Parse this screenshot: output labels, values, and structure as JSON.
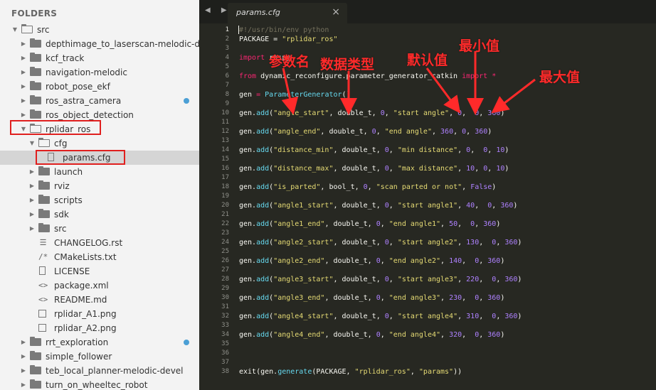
{
  "sidebar": {
    "title": "FOLDERS",
    "tree": [
      {
        "label": "src",
        "depth": 0,
        "kind": "folder",
        "open": true
      },
      {
        "label": "depthimage_to_laserscan-melodic-devel",
        "depth": 1,
        "kind": "folder"
      },
      {
        "label": "kcf_track",
        "depth": 1,
        "kind": "folder"
      },
      {
        "label": "navigation-melodic",
        "depth": 1,
        "kind": "folder"
      },
      {
        "label": "robot_pose_ekf",
        "depth": 1,
        "kind": "folder"
      },
      {
        "label": "ros_astra_camera",
        "depth": 1,
        "kind": "folder",
        "dot": true
      },
      {
        "label": "ros_object_detection",
        "depth": 1,
        "kind": "folder"
      },
      {
        "label": "rplidar_ros",
        "depth": 1,
        "kind": "folder",
        "open": true,
        "highlight": true
      },
      {
        "label": "cfg",
        "depth": 2,
        "kind": "folder",
        "open": true
      },
      {
        "label": "params.cfg",
        "depth": 3,
        "kind": "file",
        "icon": "doc",
        "selected": true,
        "highlight": true
      },
      {
        "label": "launch",
        "depth": 2,
        "kind": "folder"
      },
      {
        "label": "rviz",
        "depth": 2,
        "kind": "folder"
      },
      {
        "label": "scripts",
        "depth": 2,
        "kind": "folder"
      },
      {
        "label": "sdk",
        "depth": 2,
        "kind": "folder"
      },
      {
        "label": "src",
        "depth": 2,
        "kind": "folder"
      },
      {
        "label": "CHANGELOG.rst",
        "depth": 2,
        "kind": "file",
        "icon": "lines"
      },
      {
        "label": "CMakeLists.txt",
        "depth": 2,
        "kind": "file",
        "icon": "comment"
      },
      {
        "label": "LICENSE",
        "depth": 2,
        "kind": "file",
        "icon": "doc"
      },
      {
        "label": "package.xml",
        "depth": 2,
        "kind": "file",
        "icon": "xml"
      },
      {
        "label": "README.md",
        "depth": 2,
        "kind": "file",
        "icon": "xml"
      },
      {
        "label": "rplidar_A1.png",
        "depth": 2,
        "kind": "file",
        "icon": "img"
      },
      {
        "label": "rplidar_A2.png",
        "depth": 2,
        "kind": "file",
        "icon": "img"
      },
      {
        "label": "rrt_exploration",
        "depth": 1,
        "kind": "folder",
        "dot": true
      },
      {
        "label": "simple_follower",
        "depth": 1,
        "kind": "folder"
      },
      {
        "label": "teb_local_planner-melodic-devel",
        "depth": 1,
        "kind": "folder"
      },
      {
        "label": "turn_on_wheeltec_robot",
        "depth": 1,
        "kind": "folder"
      }
    ]
  },
  "tabbar": {
    "nav_arrows": "◀ ▶",
    "active_tab": "params.cfg",
    "close": "×"
  },
  "editor": {
    "active_line": 1,
    "lines": [
      {
        "n": 1,
        "tokens": [
          [
            "cm",
            "#!/usr/bin/env python"
          ]
        ]
      },
      {
        "n": 2,
        "tokens": [
          [
            "plain",
            "PACKAGE = "
          ],
          [
            "str",
            "\"rplidar_ros\""
          ]
        ]
      },
      {
        "n": 3,
        "tokens": []
      },
      {
        "n": 4,
        "tokens": [
          [
            "kw",
            "import"
          ],
          [
            "plain",
            " rospy"
          ]
        ]
      },
      {
        "n": 5,
        "tokens": []
      },
      {
        "n": 6,
        "tokens": [
          [
            "kw",
            "from"
          ],
          [
            "plain",
            " dynamic_reconfigure.parameter_generator_catkin "
          ],
          [
            "kw",
            "import"
          ],
          [
            "plain",
            " "
          ],
          [
            "kw",
            "*"
          ]
        ]
      },
      {
        "n": 7,
        "tokens": []
      },
      {
        "n": 8,
        "tokens": [
          [
            "plain",
            "gen "
          ],
          [
            "kw",
            "="
          ],
          [
            "plain",
            " "
          ],
          [
            "fn",
            "ParameterGenerator"
          ],
          [
            "plain",
            "()"
          ]
        ]
      },
      {
        "n": 9,
        "tokens": []
      },
      {
        "n": 10,
        "tokens": [
          [
            "plain",
            "gen."
          ],
          [
            "fn",
            "add"
          ],
          [
            "plain",
            "("
          ],
          [
            "str",
            "\"angle_start\""
          ],
          [
            "plain",
            ", double_t, "
          ],
          [
            "num",
            "0"
          ],
          [
            "plain",
            ", "
          ],
          [
            "str",
            "\"start angle\""
          ],
          [
            "plain",
            ", "
          ],
          [
            "num",
            "0"
          ],
          [
            "plain",
            ",  "
          ],
          [
            "num",
            "0"
          ],
          [
            "plain",
            ", "
          ],
          [
            "num",
            "360"
          ],
          [
            "plain",
            ")"
          ]
        ]
      },
      {
        "n": 11,
        "tokens": []
      },
      {
        "n": 12,
        "tokens": [
          [
            "plain",
            "gen."
          ],
          [
            "fn",
            "add"
          ],
          [
            "plain",
            "("
          ],
          [
            "str",
            "\"angle_end\""
          ],
          [
            "plain",
            ", double_t, "
          ],
          [
            "num",
            "0"
          ],
          [
            "plain",
            ", "
          ],
          [
            "str",
            "\"end angle\""
          ],
          [
            "plain",
            ", "
          ],
          [
            "num",
            "360"
          ],
          [
            "plain",
            ", "
          ],
          [
            "num",
            "0"
          ],
          [
            "plain",
            ", "
          ],
          [
            "num",
            "360"
          ],
          [
            "plain",
            ")"
          ]
        ]
      },
      {
        "n": 13,
        "tokens": []
      },
      {
        "n": 14,
        "tokens": [
          [
            "plain",
            "gen."
          ],
          [
            "fn",
            "add"
          ],
          [
            "plain",
            "("
          ],
          [
            "str",
            "\"distance_min\""
          ],
          [
            "plain",
            ", double_t, "
          ],
          [
            "num",
            "0"
          ],
          [
            "plain",
            ", "
          ],
          [
            "str",
            "\"min distance\""
          ],
          [
            "plain",
            ", "
          ],
          [
            "num",
            "0"
          ],
          [
            "plain",
            ",  "
          ],
          [
            "num",
            "0"
          ],
          [
            "plain",
            ", "
          ],
          [
            "num",
            "10"
          ],
          [
            "plain",
            ")"
          ]
        ]
      },
      {
        "n": 15,
        "tokens": []
      },
      {
        "n": 16,
        "tokens": [
          [
            "plain",
            "gen."
          ],
          [
            "fn",
            "add"
          ],
          [
            "plain",
            "("
          ],
          [
            "str",
            "\"distance_max\""
          ],
          [
            "plain",
            ", double_t, "
          ],
          [
            "num",
            "0"
          ],
          [
            "plain",
            ", "
          ],
          [
            "str",
            "\"max distance\""
          ],
          [
            "plain",
            ", "
          ],
          [
            "num",
            "10"
          ],
          [
            "plain",
            ", "
          ],
          [
            "num",
            "0"
          ],
          [
            "plain",
            ", "
          ],
          [
            "num",
            "10"
          ],
          [
            "plain",
            ")"
          ]
        ]
      },
      {
        "n": 17,
        "tokens": []
      },
      {
        "n": 18,
        "tokens": [
          [
            "plain",
            "gen."
          ],
          [
            "fn",
            "add"
          ],
          [
            "plain",
            "("
          ],
          [
            "str",
            "\"is_parted\""
          ],
          [
            "plain",
            ", bool_t, "
          ],
          [
            "num",
            "0"
          ],
          [
            "plain",
            ", "
          ],
          [
            "str",
            "\"scan parted or not\""
          ],
          [
            "plain",
            ", "
          ],
          [
            "num",
            "False"
          ],
          [
            "plain",
            ")"
          ]
        ]
      },
      {
        "n": 19,
        "tokens": []
      },
      {
        "n": 20,
        "tokens": [
          [
            "plain",
            "gen."
          ],
          [
            "fn",
            "add"
          ],
          [
            "plain",
            "("
          ],
          [
            "str",
            "\"angle1_start\""
          ],
          [
            "plain",
            ", double_t, "
          ],
          [
            "num",
            "0"
          ],
          [
            "plain",
            ", "
          ],
          [
            "str",
            "\"start angle1\""
          ],
          [
            "plain",
            ", "
          ],
          [
            "num",
            "40"
          ],
          [
            "plain",
            ",  "
          ],
          [
            "num",
            "0"
          ],
          [
            "plain",
            ", "
          ],
          [
            "num",
            "360"
          ],
          [
            "plain",
            ")"
          ]
        ]
      },
      {
        "n": 21,
        "tokens": []
      },
      {
        "n": 22,
        "tokens": [
          [
            "plain",
            "gen."
          ],
          [
            "fn",
            "add"
          ],
          [
            "plain",
            "("
          ],
          [
            "str",
            "\"angle1_end\""
          ],
          [
            "plain",
            ", double_t, "
          ],
          [
            "num",
            "0"
          ],
          [
            "plain",
            ", "
          ],
          [
            "str",
            "\"end angle1\""
          ],
          [
            "plain",
            ", "
          ],
          [
            "num",
            "50"
          ],
          [
            "plain",
            ",  "
          ],
          [
            "num",
            "0"
          ],
          [
            "plain",
            ", "
          ],
          [
            "num",
            "360"
          ],
          [
            "plain",
            ")"
          ]
        ]
      },
      {
        "n": 23,
        "tokens": []
      },
      {
        "n": 24,
        "tokens": [
          [
            "plain",
            "gen."
          ],
          [
            "fn",
            "add"
          ],
          [
            "plain",
            "("
          ],
          [
            "str",
            "\"angle2_start\""
          ],
          [
            "plain",
            ", double_t, "
          ],
          [
            "num",
            "0"
          ],
          [
            "plain",
            ", "
          ],
          [
            "str",
            "\"start angle2\""
          ],
          [
            "plain",
            ", "
          ],
          [
            "num",
            "130"
          ],
          [
            "plain",
            ",  "
          ],
          [
            "num",
            "0"
          ],
          [
            "plain",
            ", "
          ],
          [
            "num",
            "360"
          ],
          [
            "plain",
            ")"
          ]
        ]
      },
      {
        "n": 25,
        "tokens": []
      },
      {
        "n": 26,
        "tokens": [
          [
            "plain",
            "gen."
          ],
          [
            "fn",
            "add"
          ],
          [
            "plain",
            "("
          ],
          [
            "str",
            "\"angle2_end\""
          ],
          [
            "plain",
            ", double_t, "
          ],
          [
            "num",
            "0"
          ],
          [
            "plain",
            ", "
          ],
          [
            "str",
            "\"end angle2\""
          ],
          [
            "plain",
            ", "
          ],
          [
            "num",
            "140"
          ],
          [
            "plain",
            ",  "
          ],
          [
            "num",
            "0"
          ],
          [
            "plain",
            ", "
          ],
          [
            "num",
            "360"
          ],
          [
            "plain",
            ")"
          ]
        ]
      },
      {
        "n": 27,
        "tokens": []
      },
      {
        "n": 28,
        "tokens": [
          [
            "plain",
            "gen."
          ],
          [
            "fn",
            "add"
          ],
          [
            "plain",
            "("
          ],
          [
            "str",
            "\"angle3_start\""
          ],
          [
            "plain",
            ", double_t, "
          ],
          [
            "num",
            "0"
          ],
          [
            "plain",
            ", "
          ],
          [
            "str",
            "\"start angle3\""
          ],
          [
            "plain",
            ", "
          ],
          [
            "num",
            "220"
          ],
          [
            "plain",
            ",  "
          ],
          [
            "num",
            "0"
          ],
          [
            "plain",
            ", "
          ],
          [
            "num",
            "360"
          ],
          [
            "plain",
            ")"
          ]
        ]
      },
      {
        "n": 29,
        "tokens": []
      },
      {
        "n": 30,
        "tokens": [
          [
            "plain",
            "gen."
          ],
          [
            "fn",
            "add"
          ],
          [
            "plain",
            "("
          ],
          [
            "str",
            "\"angle3_end\""
          ],
          [
            "plain",
            ", double_t, "
          ],
          [
            "num",
            "0"
          ],
          [
            "plain",
            ", "
          ],
          [
            "str",
            "\"end angle3\""
          ],
          [
            "plain",
            ", "
          ],
          [
            "num",
            "230"
          ],
          [
            "plain",
            ",  "
          ],
          [
            "num",
            "0"
          ],
          [
            "plain",
            ", "
          ],
          [
            "num",
            "360"
          ],
          [
            "plain",
            ")"
          ]
        ]
      },
      {
        "n": 31,
        "tokens": []
      },
      {
        "n": 32,
        "tokens": [
          [
            "plain",
            "gen."
          ],
          [
            "fn",
            "add"
          ],
          [
            "plain",
            "("
          ],
          [
            "str",
            "\"angle4_start\""
          ],
          [
            "plain",
            ", double_t, "
          ],
          [
            "num",
            "0"
          ],
          [
            "plain",
            ", "
          ],
          [
            "str",
            "\"start angle4\""
          ],
          [
            "plain",
            ", "
          ],
          [
            "num",
            "310"
          ],
          [
            "plain",
            ",  "
          ],
          [
            "num",
            "0"
          ],
          [
            "plain",
            ", "
          ],
          [
            "num",
            "360"
          ],
          [
            "plain",
            ")"
          ]
        ]
      },
      {
        "n": 33,
        "tokens": []
      },
      {
        "n": 34,
        "tokens": [
          [
            "plain",
            "gen."
          ],
          [
            "fn",
            "add"
          ],
          [
            "plain",
            "("
          ],
          [
            "str",
            "\"angle4_end\""
          ],
          [
            "plain",
            ", double_t, "
          ],
          [
            "num",
            "0"
          ],
          [
            "plain",
            ", "
          ],
          [
            "str",
            "\"end angle4\""
          ],
          [
            "plain",
            ", "
          ],
          [
            "num",
            "320"
          ],
          [
            "plain",
            ",  "
          ],
          [
            "num",
            "0"
          ],
          [
            "plain",
            ", "
          ],
          [
            "num",
            "360"
          ],
          [
            "plain",
            ")"
          ]
        ]
      },
      {
        "n": 35,
        "tokens": []
      },
      {
        "n": 36,
        "tokens": []
      },
      {
        "n": 37,
        "tokens": []
      },
      {
        "n": 38,
        "tokens": [
          [
            "plain",
            "exit(gen."
          ],
          [
            "fn",
            "generate"
          ],
          [
            "plain",
            "(PACKAGE, "
          ],
          [
            "str",
            "\"rplidar_ros\""
          ],
          [
            "plain",
            ", "
          ],
          [
            "str",
            "\"params\""
          ],
          [
            "plain",
            "))"
          ]
        ]
      }
    ]
  },
  "annotations": {
    "param_name": "参数名",
    "data_type": "数据类型",
    "default_value": "默认值",
    "min_value": "最小值",
    "max_value": "最大值",
    "color": "#ff2a2a"
  }
}
